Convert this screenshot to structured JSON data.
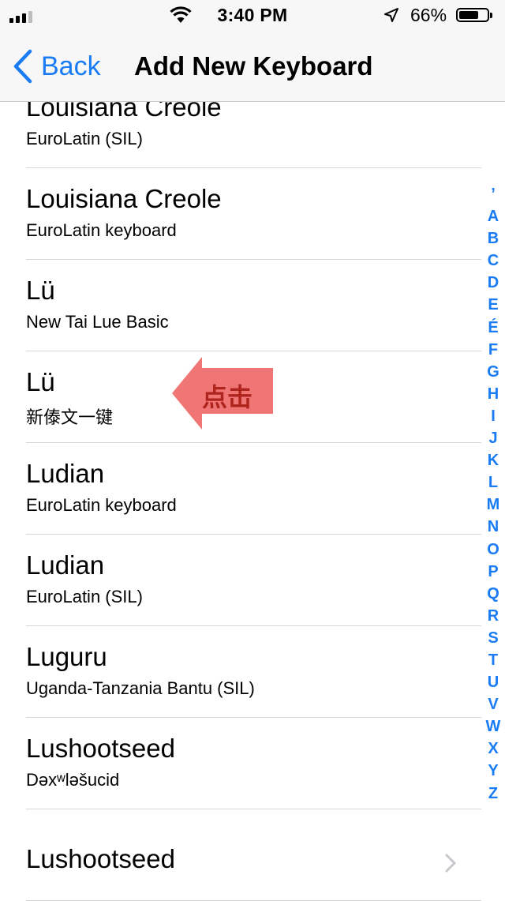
{
  "status_bar": {
    "time": "3:40 PM",
    "battery_percent": "66%",
    "signal_icon": "cellular-signal-icon",
    "wifi_icon": "wifi-icon",
    "location_icon": "location-arrow-icon",
    "battery_icon": "battery-icon"
  },
  "nav": {
    "back_label": "Back",
    "title": "Add New Keyboard"
  },
  "rows": [
    {
      "title": "Louisiana Creole",
      "subtitle": "EuroLatin (SIL)"
    },
    {
      "title": "Louisiana Creole",
      "subtitle": "EuroLatin keyboard"
    },
    {
      "title": "Lü",
      "subtitle": "New Tai Lue Basic"
    },
    {
      "title": "Lü",
      "subtitle": "新傣文一键"
    },
    {
      "title": "Ludian",
      "subtitle": "EuroLatin keyboard"
    },
    {
      "title": "Ludian",
      "subtitle": "EuroLatin (SIL)"
    },
    {
      "title": "Luguru",
      "subtitle": "Uganda-Tanzania Bantu (SIL)"
    },
    {
      "title": "Lushootseed",
      "subtitle": "Dəxʷləšucid"
    },
    {
      "title": "Lushootseed",
      "subtitle": ""
    }
  ],
  "index": [
    "’",
    "A",
    "B",
    "C",
    "D",
    "E",
    "É",
    "F",
    "G",
    "H",
    "I",
    "J",
    "K",
    "L",
    "M",
    "N",
    "O",
    "P",
    "Q",
    "R",
    "S",
    "T",
    "U",
    "V",
    "W",
    "X",
    "Y",
    "Z"
  ],
  "annotation": {
    "label": "点击",
    "color": "#f07575",
    "text_color": "#b0241e"
  },
  "colors": {
    "accent": "#1a7cf5",
    "bar_background": "#f7f7f7"
  }
}
